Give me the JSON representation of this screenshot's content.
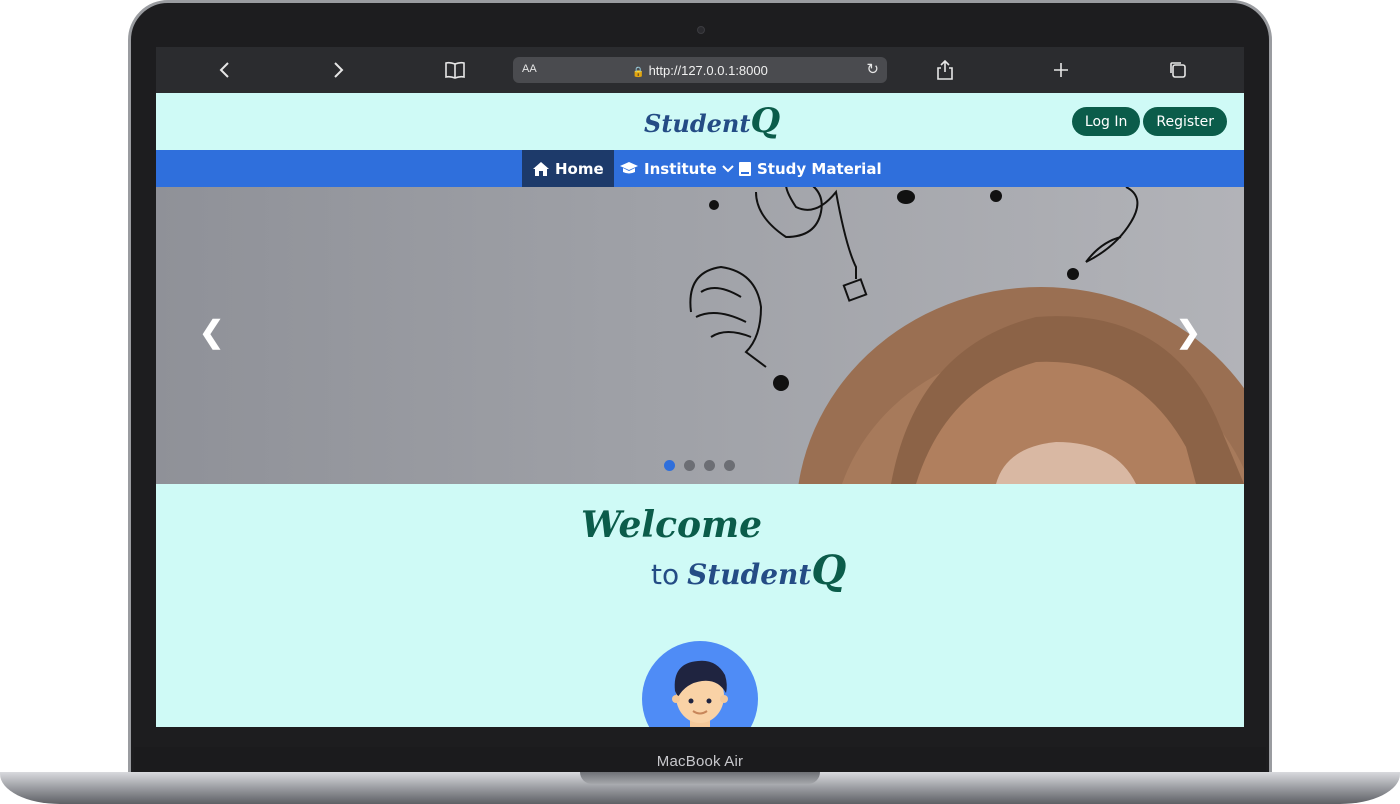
{
  "device": {
    "label": "MacBook Air"
  },
  "browser": {
    "url": "http://127.0.0.1:8000",
    "aa_label": "AA",
    "icons": {
      "back": "chevron-left-icon",
      "forward": "chevron-right-icon",
      "bookmarks": "book-icon",
      "share": "share-icon",
      "new_tab": "plus-icon",
      "tabs": "tabs-icon",
      "reload": "reload-icon",
      "lock": "lock-icon"
    }
  },
  "header": {
    "logo_text": "Student",
    "logo_q": "Q",
    "login_label": "Log In",
    "register_label": "Register"
  },
  "nav": {
    "items": [
      {
        "label": "Home",
        "icon": "home-icon",
        "active": true
      },
      {
        "label": "Institute",
        "icon": "graduation-cap-icon",
        "dropdown": true
      },
      {
        "label": "Study Material",
        "icon": "book-icon"
      }
    ]
  },
  "carousel": {
    "prev_label": "❮",
    "next_label": "❯",
    "slide_count": 4,
    "active_index": 0
  },
  "welcome": {
    "line1": "Welcome",
    "line2_to": "to",
    "brand": "Student",
    "brand_q": "Q"
  },
  "colors": {
    "page_bg": "#cffaf6",
    "nav_bg": "#2f6fdc",
    "nav_active": "#1d3a6a",
    "button_bg": "#0b5c4a",
    "brand_blue": "#244c85",
    "brand_green": "#0b5c4a"
  }
}
